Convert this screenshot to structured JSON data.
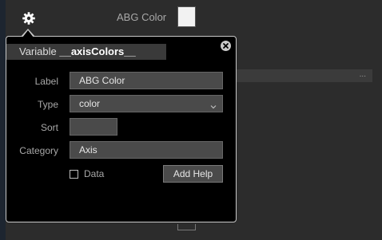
{
  "background": {
    "property_label": "ABG Color",
    "swatch_color": "#f2f2f2",
    "row_dots": "..."
  },
  "popup": {
    "header_prefix": "Variable",
    "variable_name": "__axisColors__",
    "fields": {
      "label": {
        "caption": "Label",
        "value": "ABG Color"
      },
      "type": {
        "caption": "Type",
        "value": "color"
      },
      "sort": {
        "caption": "Sort",
        "value": ""
      },
      "category": {
        "caption": "Category",
        "value": "Axis"
      }
    },
    "data_checkbox": {
      "label": "Data",
      "checked": false
    },
    "add_help_label": "Add Help"
  },
  "icons": {
    "settings": "gear-icon",
    "close": "close-icon",
    "select": "chevron-down-icon"
  },
  "colors": {
    "popup_bg": "#000000",
    "field_bg": "#4a4a4a",
    "panel_bg": "#2c2c2c"
  }
}
